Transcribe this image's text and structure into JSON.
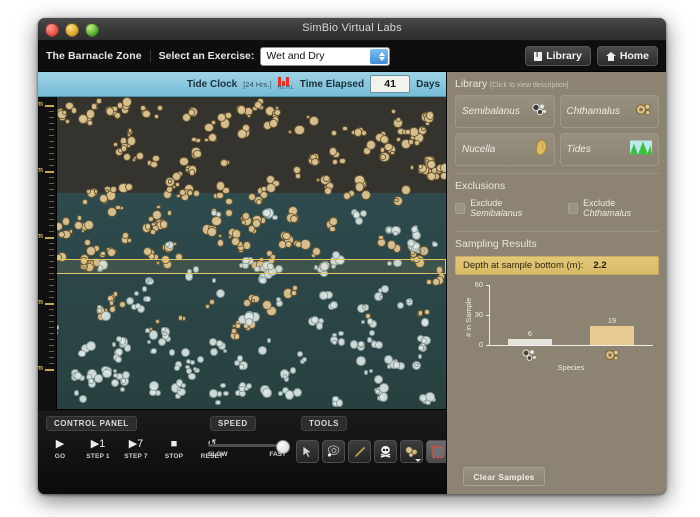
{
  "window": {
    "title": "SimBio Virtual Labs",
    "traffic_lights": [
      "close-button",
      "minimize-button",
      "zoom-button"
    ]
  },
  "toolbar": {
    "app_title": "The Barnacle Zone",
    "exercise_label": "Select an Exercise:",
    "exercise_value": "Wet and Dry",
    "library_button": "Library",
    "home_button": "Home"
  },
  "sim_header": {
    "tide_clock_label": "Tide Clock",
    "tide_clock_sub": "[24 Hrs.]",
    "tide_marks": [
      "H",
      "L",
      "H",
      "L"
    ],
    "time_elapsed_label": "Time Elapsed",
    "days_value": "41",
    "days_unit": "Days"
  },
  "sim_view": {
    "depth_ticks": [
      "5m",
      "4m",
      "3m",
      "2m",
      "1m"
    ],
    "dry_zone_color": "#34332e",
    "wet_zone_color": "#2e4a4c",
    "chthamalus_color": "#ddc493",
    "semibalanus_color": "#dde7e4",
    "sample_box_color": "#e4c563"
  },
  "control_panel": {
    "panel_label": "CONTROL PANEL",
    "speed_label": "SPEED",
    "tools_label": "TOOLS",
    "buttons": [
      {
        "glyph": "▶",
        "label": "GO",
        "name": "go-button"
      },
      {
        "glyph": "▶1",
        "label": "STEP 1",
        "name": "step-1-button"
      },
      {
        "glyph": "▶7",
        "label": "STEP 7",
        "name": "step-7-button"
      },
      {
        "glyph": "■",
        "label": "STOP",
        "name": "stop-button"
      },
      {
        "glyph": "↺",
        "label": "RESET",
        "name": "reset-button"
      }
    ],
    "speed_min": "SLOW",
    "speed_max": "FAST",
    "speed_value": 100,
    "tools": [
      {
        "name": "pointer-tool",
        "icon": "arrow-cursor-icon"
      },
      {
        "name": "nucella-tool",
        "icon": "snail-icon"
      },
      {
        "name": "draw-tool",
        "icon": "pencil-icon"
      },
      {
        "name": "kill-tool",
        "icon": "skull-icon"
      },
      {
        "name": "add-barnacle-tool",
        "icon": "barnacle-cluster-icon"
      },
      {
        "name": "sample-box-tool",
        "icon": "dashed-square-icon"
      },
      {
        "name": "data-table-tool",
        "icon": "grid-table-icon"
      }
    ]
  },
  "library": {
    "heading": "Library",
    "hint": "[Click to view description]",
    "items": [
      {
        "label": "Semibalanus",
        "icon": "semibalanus-icon"
      },
      {
        "label": "Chthamalus",
        "icon": "chthamalus-icon"
      },
      {
        "label": "Nucella",
        "icon": "nucella-snail-icon"
      },
      {
        "label": "Tides",
        "icon": "tides-chart-icon"
      }
    ]
  },
  "exclusions": {
    "heading": "Exclusions",
    "options": [
      {
        "label_prefix": "Exclude ",
        "species": "Semibalanus",
        "checked": false
      },
      {
        "label_prefix": "Exclude ",
        "species": "Chthamalus",
        "checked": false
      }
    ]
  },
  "sampling": {
    "heading": "Sampling Results",
    "depth_label": "Depth at sample bottom (m):",
    "depth_value": "2.2",
    "clear_button": "Clear Samples"
  },
  "chart_data": {
    "type": "bar",
    "title": "Sampling Results",
    "categories": [
      "Semibalanus",
      "Chthamalus"
    ],
    "category_icons": [
      "semibalanus-icon",
      "chthamalus-icon"
    ],
    "values": [
      6,
      19
    ],
    "value_labels": [
      "6",
      "19"
    ],
    "bar_colors": [
      "#e3e3dc",
      "#e6cb92"
    ],
    "xlabel": "Species",
    "ylabel": "# in Sample",
    "ylim": [
      0,
      60
    ],
    "yticks": [
      0,
      30,
      60
    ],
    "ytick_labels": [
      "0",
      "30",
      "60"
    ],
    "grid": false,
    "legend": false
  }
}
